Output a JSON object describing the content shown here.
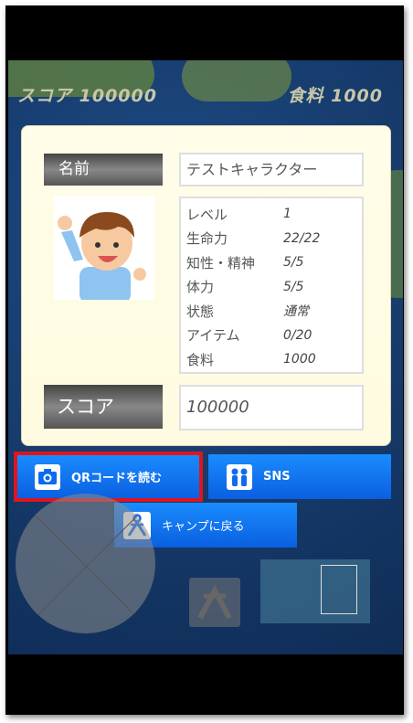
{
  "hud": {
    "score_label": "スコア",
    "score_value": "100000",
    "food_label": "食料",
    "food_value": "1000"
  },
  "character": {
    "name_label": "名前",
    "name": "テストキャラクター",
    "stats": [
      {
        "key": "レベル",
        "value": "1"
      },
      {
        "key": "生命力",
        "value": "22/22"
      },
      {
        "key": "知性・精神",
        "value": "5/5"
      },
      {
        "key": "体力",
        "value": "5/5"
      },
      {
        "key": "状態",
        "value": "通常"
      },
      {
        "key": "アイテム",
        "value": "0/20"
      },
      {
        "key": "食料",
        "value": "1000"
      }
    ],
    "score_label": "スコア",
    "score_value": "100000"
  },
  "buttons": {
    "qr": {
      "label": "QRコードを読む",
      "icon": "camera-icon"
    },
    "sns": {
      "label": "SNS",
      "icon": "people-icon"
    },
    "camp": {
      "label": "キャンプに戻る",
      "icon": "tent-icon"
    }
  },
  "colors": {
    "button": "#0a6cf0",
    "highlight": "#e0141c",
    "panel": "#fffde9"
  }
}
